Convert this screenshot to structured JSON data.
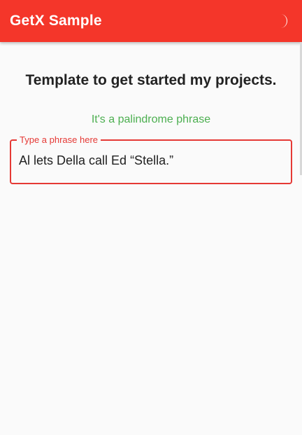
{
  "app_bar": {
    "title": "GetX Sample",
    "toggle_icon": "moon-icon",
    "background": "#f4362a"
  },
  "main": {
    "heading": "Template to get started my projects.",
    "status": "It's a palindrome phrase",
    "status_color": "#4caf50"
  },
  "phrase_field": {
    "label": "Type a phrase here",
    "value": "Al lets Della call Ed “Stella.”",
    "border_color": "#e53935"
  }
}
